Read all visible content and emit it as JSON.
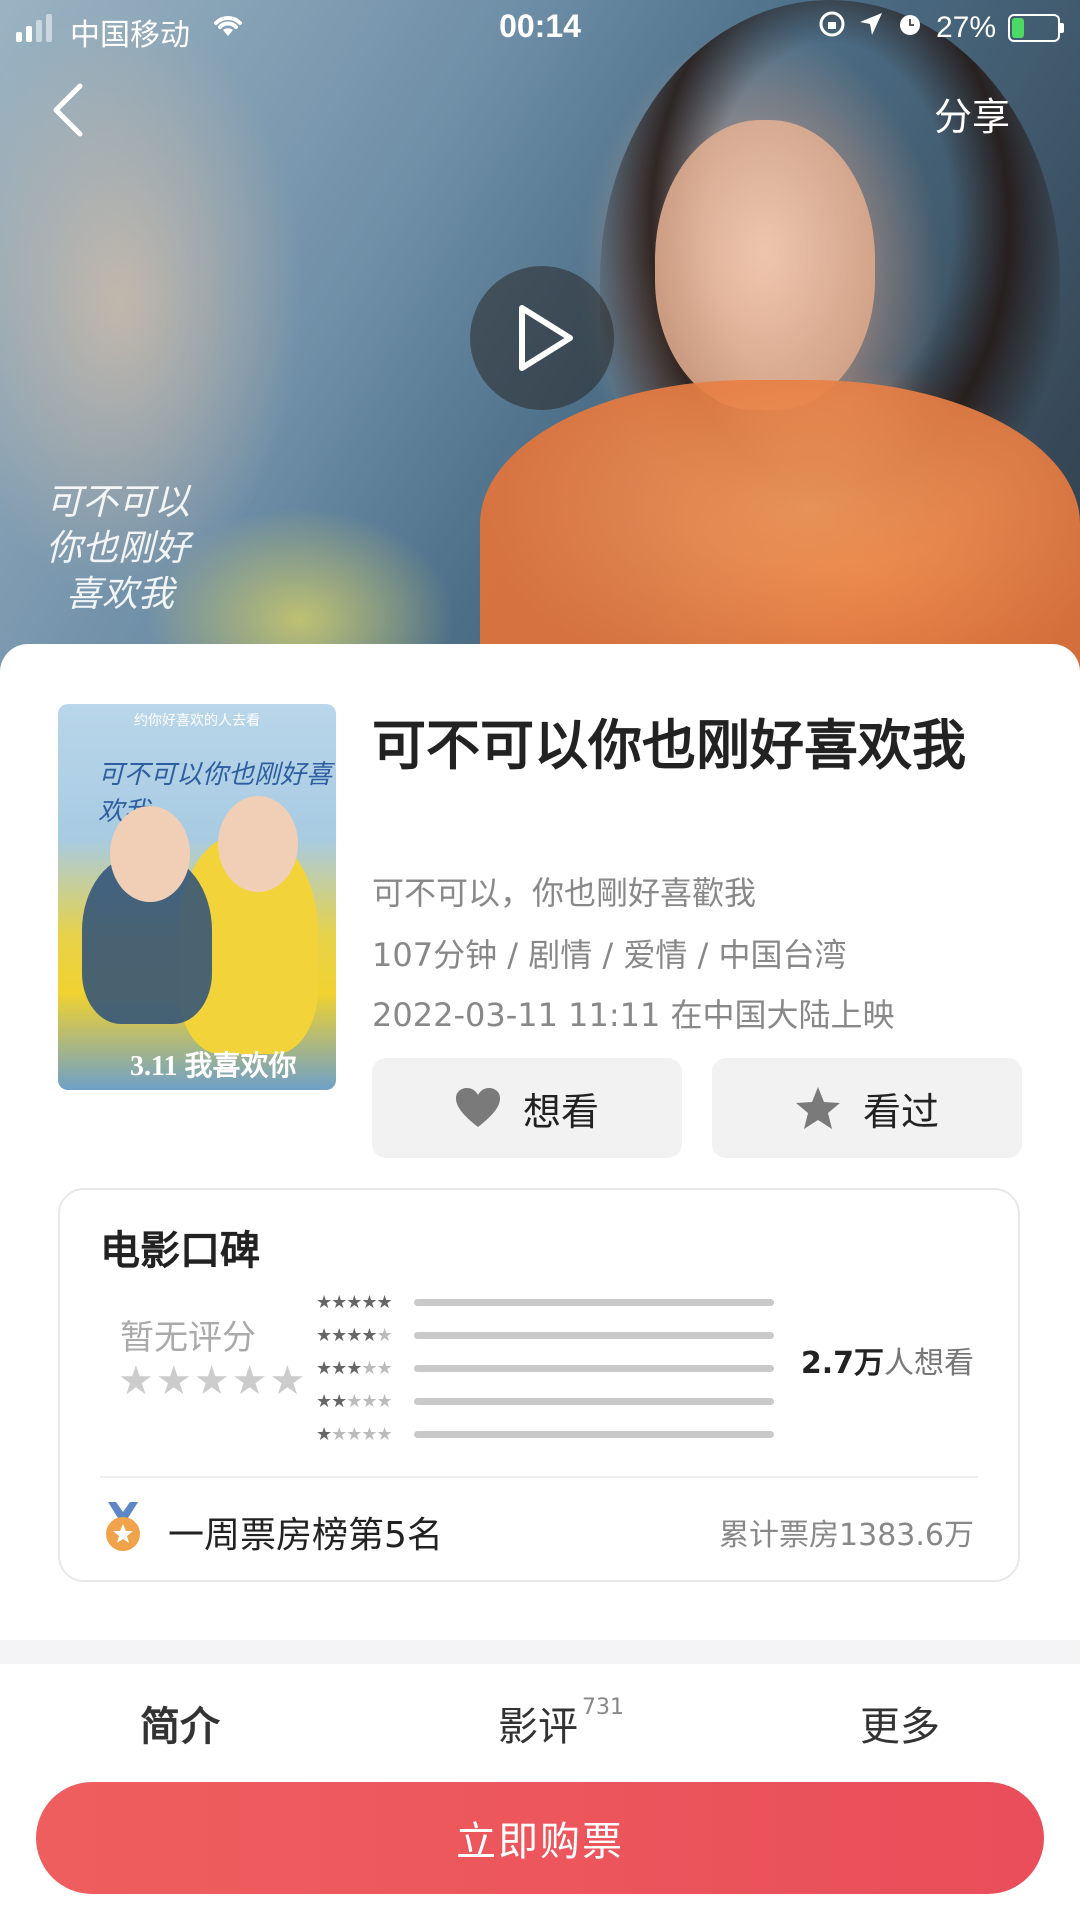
{
  "status_bar": {
    "carrier": "中国移动",
    "time": "00:14",
    "battery": "27%"
  },
  "header": {
    "share_label": "分享"
  },
  "hero": {
    "calligraphy_lines": [
      "可不可以",
      "你也刚好",
      "喜欢我"
    ]
  },
  "movie": {
    "title": "可不可以你也刚好喜欢我",
    "original_title": "可不可以，你也剛好喜歡我",
    "meta": "107分钟 / 剧情 / 爱情 / 中国台湾",
    "release": "2022-03-11 11:11 在中国大陆上映",
    "poster_tagline": "约你好喜欢的人去看",
    "poster_title": "可不可以你也刚好喜欢我",
    "poster_date": "3.11 我喜欢你"
  },
  "actions": {
    "want_label": "想看",
    "seen_label": "看过"
  },
  "rating_card": {
    "title": "电影口碑",
    "no_rating": "暂无评分",
    "big_stars": "★★★★★",
    "distribution": [
      {
        "filled": "★★★★★",
        "empty": ""
      },
      {
        "filled": "★★★★",
        "empty": "★"
      },
      {
        "filled": "★★★",
        "empty": "★★"
      },
      {
        "filled": "★★",
        "empty": "★★★"
      },
      {
        "filled": "★",
        "empty": "★★★★"
      }
    ],
    "wish_count": "2.7万",
    "wish_suffix": "人想看",
    "rank_text": "一周票房榜第5名",
    "box_office": "累计票房1383.6万"
  },
  "tabs": {
    "intro": "简介",
    "review": "影评",
    "review_count": "731",
    "more": "更多"
  },
  "buy_button": "立即购票"
}
